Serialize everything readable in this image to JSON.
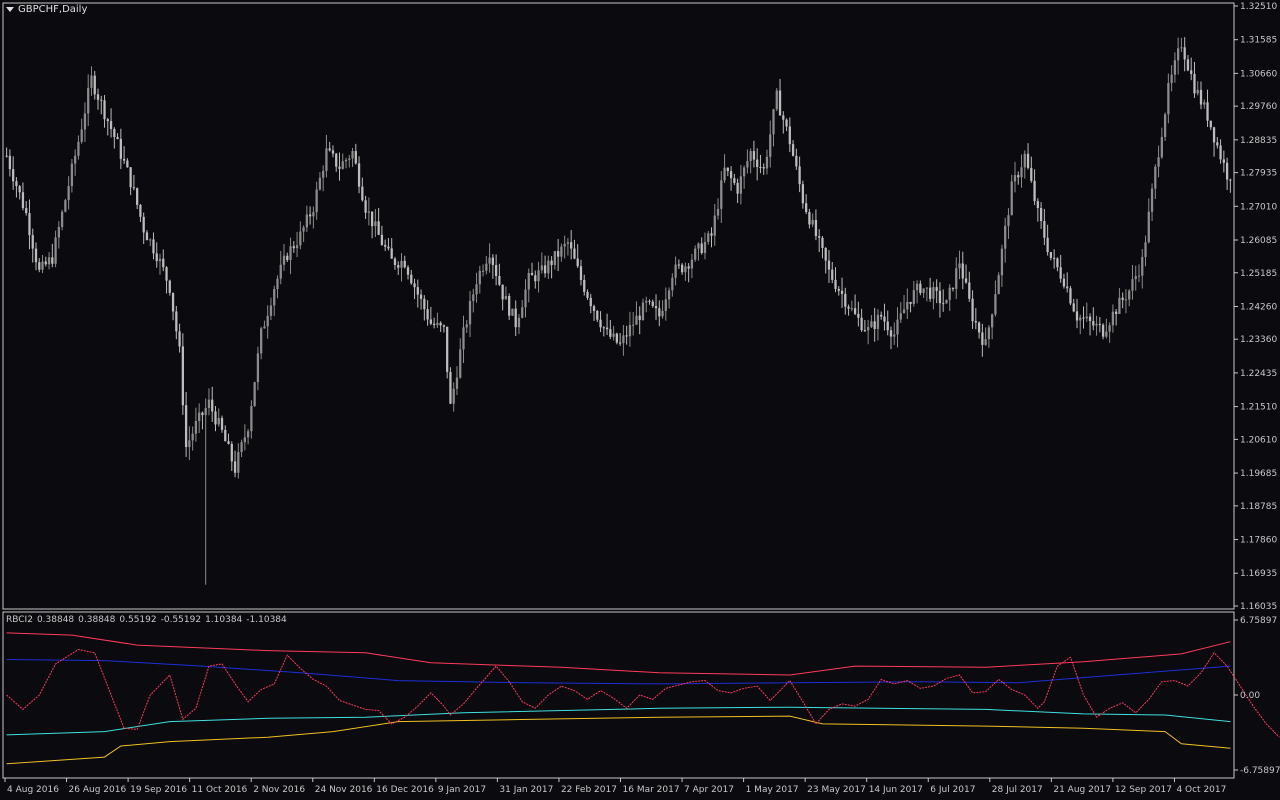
{
  "window": {
    "symbol": "GBPCHF,Daily",
    "indicator_name": "RBCI2",
    "indicator_values": [
      "0.38848",
      "0.38848",
      "0.55192",
      "-0.55192",
      "1.10384",
      "-1.10384"
    ]
  },
  "colors": {
    "background": "#0a0a0f",
    "frame": "#c8c8c8",
    "candle_up": "#8c8c8c",
    "candle_down": "#bdbdbd",
    "line_red_upper": "#ff3b5c",
    "line_blue": "#1e2fd6",
    "line_cyan": "#3fe0e0",
    "line_yellow": "#f0c020",
    "line_oscillator": "#ff3b5c"
  },
  "chart_data": [
    {
      "type": "candlestick",
      "title": "GBPCHF,Daily",
      "x_tick_labels": [
        "4 Aug 2016",
        "26 Aug 2016",
        "19 Sep 2016",
        "11 Oct 2016",
        "2 Nov 2016",
        "24 Nov 2016",
        "16 Dec 2016",
        "9 Jan 2017",
        "31 Jan 2017",
        "22 Feb 2017",
        "16 Mar 2017",
        "7 Apr 2017",
        "1 May 2017",
        "23 May 2017",
        "14 Jun 2017",
        "6 Jul 2017",
        "28 Jul 2017",
        "21 Aug 2017",
        "12 Sep 2017",
        "4 Oct 2017"
      ],
      "y_tick_labels": [
        "1.32510",
        "1.31585",
        "1.30660",
        "1.29760",
        "1.28835",
        "1.27935",
        "1.27010",
        "1.26085",
        "1.25185",
        "1.24260",
        "1.23360",
        "1.22435",
        "1.21510",
        "1.20610",
        "1.19685",
        "1.18785",
        "1.17860",
        "1.16935",
        "1.16035"
      ],
      "ylim": [
        1.16035,
        1.3251
      ],
      "close_anchors": [
        [
          0,
          1.284
        ],
        [
          6,
          1.268
        ],
        [
          10,
          1.252
        ],
        [
          14,
          1.256
        ],
        [
          18,
          1.272
        ],
        [
          22,
          1.288
        ],
        [
          26,
          1.305
        ],
        [
          30,
          1.296
        ],
        [
          34,
          1.287
        ],
        [
          38,
          1.277
        ],
        [
          42,
          1.264
        ],
        [
          46,
          1.257
        ],
        [
          50,
          1.248
        ],
        [
          53,
          1.23
        ],
        [
          55,
          1.204
        ],
        [
          58,
          1.21
        ],
        [
          62,
          1.216
        ],
        [
          66,
          1.208
        ],
        [
          70,
          1.198
        ],
        [
          74,
          1.21
        ],
        [
          78,
          1.235
        ],
        [
          82,
          1.248
        ],
        [
          86,
          1.257
        ],
        [
          90,
          1.262
        ],
        [
          94,
          1.27
        ],
        [
          98,
          1.285
        ],
        [
          102,
          1.281
        ],
        [
          106,
          1.285
        ],
        [
          110,
          1.27
        ],
        [
          114,
          1.262
        ],
        [
          118,
          1.255
        ],
        [
          122,
          1.255
        ],
        [
          126,
          1.246
        ],
        [
          130,
          1.238
        ],
        [
          134,
          1.236
        ],
        [
          136,
          1.215
        ],
        [
          140,
          1.235
        ],
        [
          144,
          1.25
        ],
        [
          148,
          1.258
        ],
        [
          152,
          1.246
        ],
        [
          156,
          1.238
        ],
        [
          160,
          1.25
        ],
        [
          164,
          1.252
        ],
        [
          168,
          1.256
        ],
        [
          172,
          1.26
        ],
        [
          176,
          1.25
        ],
        [
          180,
          1.242
        ],
        [
          184,
          1.235
        ],
        [
          188,
          1.232
        ],
        [
          192,
          1.238
        ],
        [
          196,
          1.243
        ],
        [
          200,
          1.24
        ],
        [
          204,
          1.252
        ],
        [
          208,
          1.254
        ],
        [
          212,
          1.258
        ],
        [
          216,
          1.262
        ],
        [
          220,
          1.28
        ],
        [
          224,
          1.275
        ],
        [
          228,
          1.285
        ],
        [
          232,
          1.28
        ],
        [
          236,
          1.3
        ],
        [
          240,
          1.288
        ],
        [
          244,
          1.272
        ],
        [
          248,
          1.262
        ],
        [
          252,
          1.252
        ],
        [
          256,
          1.246
        ],
        [
          260,
          1.24
        ],
        [
          264,
          1.236
        ],
        [
          268,
          1.24
        ],
        [
          272,
          1.235
        ],
        [
          276,
          1.244
        ],
        [
          280,
          1.248
        ],
        [
          284,
          1.246
        ],
        [
          288,
          1.243
        ],
        [
          292,
          1.255
        ],
        [
          296,
          1.24
        ],
        [
          300,
          1.232
        ],
        [
          304,
          1.252
        ],
        [
          308,
          1.275
        ],
        [
          312,
          1.284
        ],
        [
          316,
          1.268
        ],
        [
          320,
          1.256
        ],
        [
          324,
          1.25
        ],
        [
          328,
          1.24
        ],
        [
          332,
          1.238
        ],
        [
          336,
          1.236
        ],
        [
          340,
          1.242
        ],
        [
          344,
          1.247
        ],
        [
          348,
          1.255
        ],
        [
          352,
          1.28
        ],
        [
          356,
          1.302
        ],
        [
          360,
          1.315
        ],
        [
          364,
          1.303
        ],
        [
          368,
          1.295
        ],
        [
          372,
          1.284
        ],
        [
          374,
          1.279
        ]
      ]
    },
    {
      "type": "line",
      "title": "RBCI2",
      "y_tick_labels": [
        "6.75897",
        "0.00",
        "-6.75897"
      ],
      "ylim": [
        -6.75897,
        6.75897
      ],
      "series": [
        {
          "key": "upper_red",
          "color": "#ff3b5c",
          "points": [
            [
              0,
              5.6
            ],
            [
              20,
              5.4
            ],
            [
              40,
              4.5
            ],
            [
              80,
              4.0
            ],
            [
              110,
              3.8
            ],
            [
              130,
              2.9
            ],
            [
              170,
              2.5
            ],
            [
              200,
              2.0
            ],
            [
              240,
              1.8
            ],
            [
              260,
              2.6
            ],
            [
              300,
              2.5
            ],
            [
              330,
              3.0
            ],
            [
              360,
              3.7
            ],
            [
              375,
              4.8
            ]
          ]
        },
        {
          "key": "blue",
          "color": "#1e2fd6",
          "points": [
            [
              0,
              3.2
            ],
            [
              30,
              3.1
            ],
            [
              60,
              2.6
            ],
            [
              90,
              2.0
            ],
            [
              120,
              1.3
            ],
            [
              160,
              1.1
            ],
            [
              200,
              1.0
            ],
            [
              240,
              1.1
            ],
            [
              280,
              1.2
            ],
            [
              310,
              1.1
            ],
            [
              340,
              1.8
            ],
            [
              375,
              2.6
            ]
          ]
        },
        {
          "key": "cyan",
          "color": "#3fe0e0",
          "points": [
            [
              0,
              -3.6
            ],
            [
              30,
              -3.3
            ],
            [
              50,
              -2.4
            ],
            [
              80,
              -2.1
            ],
            [
              110,
              -2.0
            ],
            [
              140,
              -1.6
            ],
            [
              200,
              -1.2
            ],
            [
              240,
              -1.1
            ],
            [
              300,
              -1.3
            ],
            [
              330,
              -1.7
            ],
            [
              355,
              -1.8
            ],
            [
              375,
              -2.4
            ]
          ]
        },
        {
          "key": "yellow",
          "color": "#f0c020",
          "points": [
            [
              0,
              -6.2
            ],
            [
              30,
              -5.6
            ],
            [
              35,
              -4.6
            ],
            [
              50,
              -4.2
            ],
            [
              80,
              -3.8
            ],
            [
              100,
              -3.3
            ],
            [
              120,
              -2.4
            ],
            [
              160,
              -2.2
            ],
            [
              200,
              -2.0
            ],
            [
              240,
              -1.9
            ],
            [
              250,
              -2.6
            ],
            [
              300,
              -2.8
            ],
            [
              330,
              -3.0
            ],
            [
              355,
              -3.3
            ],
            [
              360,
              -4.4
            ],
            [
              375,
              -4.8
            ]
          ]
        },
        {
          "key": "oscillator",
          "color": "#ff3b5c",
          "points": [
            [
              0,
              0.0
            ],
            [
              5,
              -1.3
            ],
            [
              10,
              0.0
            ],
            [
              15,
              2.8
            ],
            [
              22,
              4.1
            ],
            [
              27,
              3.8
            ],
            [
              32,
              0.0
            ],
            [
              36,
              -3.0
            ],
            [
              40,
              -3.1
            ],
            [
              44,
              0.0
            ],
            [
              50,
              1.8
            ],
            [
              54,
              -2.2
            ],
            [
              58,
              -1.2
            ],
            [
              62,
              2.6
            ],
            [
              66,
              2.8
            ],
            [
              70,
              1.0
            ],
            [
              74,
              -0.6
            ],
            [
              78,
              0.5
            ],
            [
              82,
              1.0
            ],
            [
              86,
              3.6
            ],
            [
              90,
              2.4
            ],
            [
              94,
              1.4
            ],
            [
              98,
              0.8
            ],
            [
              102,
              -0.5
            ],
            [
              106,
              -0.9
            ],
            [
              110,
              -1.3
            ],
            [
              114,
              -1.4
            ],
            [
              118,
              -2.6
            ],
            [
              122,
              -2.0
            ],
            [
              126,
              -1.0
            ],
            [
              130,
              0.2
            ],
            [
              134,
              -1.0
            ],
            [
              136,
              -1.8
            ],
            [
              140,
              -0.8
            ],
            [
              144,
              0.6
            ],
            [
              150,
              2.6
            ],
            [
              154,
              1.2
            ],
            [
              158,
              -0.6
            ],
            [
              162,
              -1.2
            ],
            [
              166,
              0.0
            ],
            [
              170,
              0.8
            ],
            [
              174,
              0.4
            ],
            [
              178,
              -0.4
            ],
            [
              182,
              0.4
            ],
            [
              186,
              -0.3
            ],
            [
              190,
              -1.2
            ],
            [
              194,
              0.0
            ],
            [
              198,
              -0.4
            ],
            [
              202,
              0.6
            ],
            [
              206,
              0.9
            ],
            [
              210,
              1.2
            ],
            [
              214,
              1.3
            ],
            [
              218,
              0.4
            ],
            [
              222,
              0.2
            ],
            [
              226,
              0.6
            ],
            [
              230,
              0.8
            ],
            [
              234,
              -0.5
            ],
            [
              238,
              0.7
            ],
            [
              240,
              1.3
            ],
            [
              244,
              -0.6
            ],
            [
              248,
              -2.6
            ],
            [
              252,
              -1.3
            ],
            [
              256,
              -0.8
            ],
            [
              260,
              -1.0
            ],
            [
              264,
              -0.4
            ],
            [
              268,
              1.4
            ],
            [
              272,
              1.0
            ],
            [
              276,
              1.3
            ],
            [
              280,
              0.6
            ],
            [
              284,
              0.8
            ],
            [
              288,
              1.5
            ],
            [
              292,
              1.8
            ],
            [
              296,
              0.2
            ],
            [
              300,
              0.3
            ],
            [
              304,
              1.4
            ],
            [
              308,
              0.5
            ],
            [
              312,
              0.0
            ],
            [
              316,
              -1.2
            ],
            [
              318,
              -0.6
            ],
            [
              322,
              2.6
            ],
            [
              326,
              3.4
            ],
            [
              330,
              0.0
            ],
            [
              334,
              -2.0
            ],
            [
              338,
              -1.2
            ],
            [
              342,
              -0.7
            ],
            [
              346,
              -1.6
            ],
            [
              350,
              -0.4
            ],
            [
              354,
              1.2
            ],
            [
              358,
              1.3
            ],
            [
              362,
              0.8
            ],
            [
              366,
              2.0
            ],
            [
              370,
              3.8
            ],
            [
              374,
              2.6
            ],
            [
              378,
              0.8
            ],
            [
              382,
              -1.0
            ],
            [
              386,
              -2.6
            ],
            [
              390,
              -3.8
            ]
          ]
        }
      ]
    }
  ]
}
